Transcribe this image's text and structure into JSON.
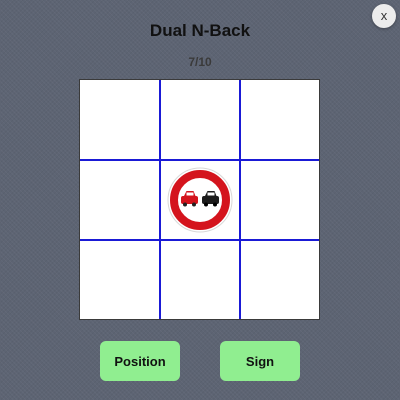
{
  "window": {
    "close_label": "x"
  },
  "game": {
    "title": "Dual N-Back",
    "progress": "7/10",
    "grid": {
      "rows": 3,
      "cols": 3,
      "active_cell": {
        "row": 2,
        "col": 2
      },
      "stimulus_icon": "no-overtaking-sign-icon"
    }
  },
  "buttons": {
    "position_label": "Position",
    "sign_label": "Sign"
  },
  "colors": {
    "grid_lines": "#1a1ad6",
    "button_bg": "#90ee90",
    "sign_ring": "#d4141d",
    "car_left": "#d4141d",
    "car_right": "#1c1c1c"
  }
}
